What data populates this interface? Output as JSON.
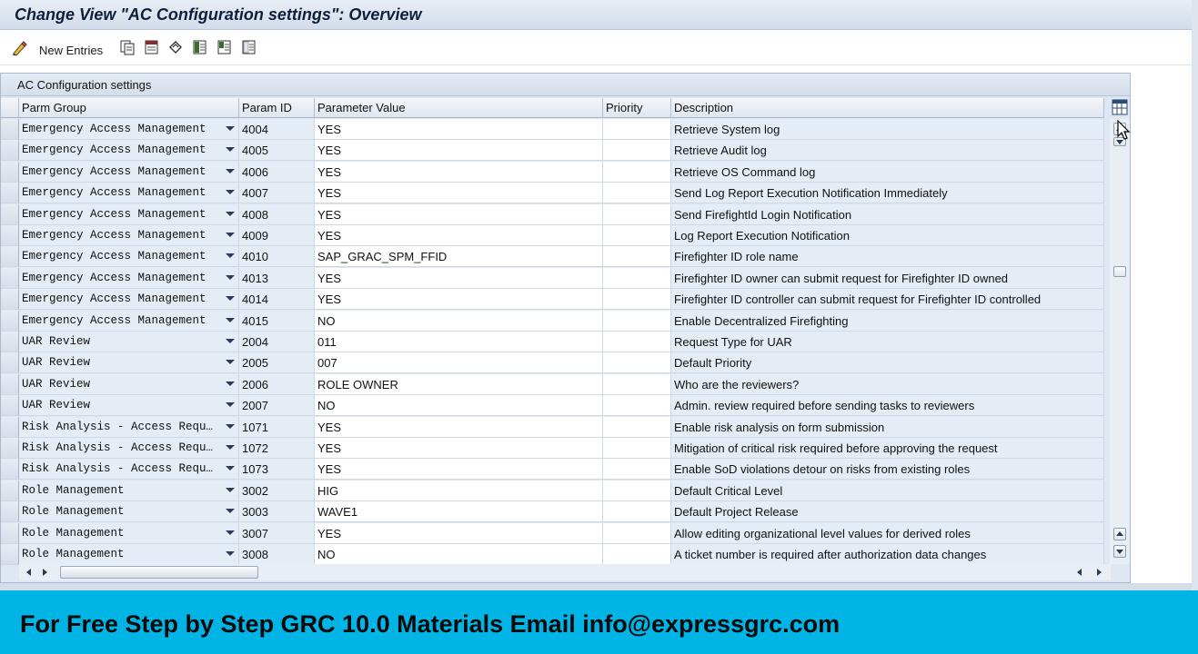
{
  "window": {
    "title": "Change View \"AC Configuration settings\": Overview"
  },
  "toolbar": {
    "new_entries_label": "New Entries",
    "icons": [
      "change-display-icon",
      "copy-as-icon",
      "delete-icon",
      "undo-change-icon",
      "select-all-icon",
      "select-block-icon",
      "deselect-all-icon"
    ]
  },
  "table": {
    "caption": "AC Configuration settings",
    "columns": [
      "Parm Group",
      "Param ID",
      "Parameter Value",
      "Priority",
      "Description"
    ],
    "rows": [
      {
        "group": "Emergency Access Management",
        "param_id": "4004",
        "value": "YES",
        "priority": "",
        "description": "Retrieve System log"
      },
      {
        "group": "Emergency Access Management",
        "param_id": "4005",
        "value": "YES",
        "priority": "",
        "description": "Retrieve Audit log"
      },
      {
        "group": "Emergency Access Management",
        "param_id": "4006",
        "value": "YES",
        "priority": "",
        "description": "Retrieve OS Command log"
      },
      {
        "group": "Emergency Access Management",
        "param_id": "4007",
        "value": "YES",
        "priority": "",
        "description": "Send Log Report Execution Notification Immediately"
      },
      {
        "group": "Emergency Access Management",
        "param_id": "4008",
        "value": "YES",
        "priority": "",
        "description": "Send FirefightId Login Notification"
      },
      {
        "group": "Emergency Access Management",
        "param_id": "4009",
        "value": "YES",
        "priority": "",
        "description": "Log Report Execution Notification"
      },
      {
        "group": "Emergency Access Management",
        "param_id": "4010",
        "value": "SAP_GRAC_SPM_FFID",
        "priority": "",
        "description": "Firefighter ID role name"
      },
      {
        "group": "Emergency Access Management",
        "param_id": "4013",
        "value": "YES",
        "priority": "",
        "description": "Firefighter ID owner can submit request for Firefighter ID owned"
      },
      {
        "group": "Emergency Access Management",
        "param_id": "4014",
        "value": "YES",
        "priority": "",
        "description": "Firefighter ID controller can submit request for Firefighter ID controlled"
      },
      {
        "group": "Emergency Access Management",
        "param_id": "4015",
        "value": "NO",
        "priority": "",
        "description": "Enable Decentralized Firefighting"
      },
      {
        "group": "UAR Review",
        "param_id": "2004",
        "value": "011",
        "priority": "",
        "description": "Request Type for UAR"
      },
      {
        "group": "UAR Review",
        "param_id": "2005",
        "value": "007",
        "priority": "",
        "description": "Default Priority"
      },
      {
        "group": "UAR Review",
        "param_id": "2006",
        "value": "ROLE OWNER",
        "priority": "",
        "description": "Who are the reviewers?"
      },
      {
        "group": "UAR Review",
        "param_id": "2007",
        "value": "NO",
        "priority": "",
        "description": "Admin. review required before sending tasks to reviewers"
      },
      {
        "group": "Risk Analysis - Access Requ…",
        "param_id": "1071",
        "value": "YES",
        "priority": "",
        "description": "Enable risk analysis on form submission"
      },
      {
        "group": "Risk Analysis - Access Requ…",
        "param_id": "1072",
        "value": "YES",
        "priority": "",
        "description": "Mitigation of critical risk required before approving the request"
      },
      {
        "group": "Risk Analysis - Access Requ…",
        "param_id": "1073",
        "value": "YES",
        "priority": "",
        "description": "Enable SoD violations detour on risks from existing roles"
      },
      {
        "group": "Role Management",
        "param_id": "3002",
        "value": "HIG",
        "priority": "",
        "description": "Default Critical Level"
      },
      {
        "group": "Role Management",
        "param_id": "3003",
        "value": "WAVE1",
        "priority": "",
        "description": "Default Project Release"
      },
      {
        "group": "Role Management",
        "param_id": "3007",
        "value": "YES",
        "priority": "",
        "description": "Allow editing organizational level values for derived roles"
      },
      {
        "group": "Role Management",
        "param_id": "3008",
        "value": "NO",
        "priority": "",
        "description": "A ticket number is required after authorization data changes"
      }
    ]
  },
  "banner": {
    "text": "For Free Step by Step GRC 10.0 Materials Email info@expressgrc.com"
  },
  "colors": {
    "banner_bg": "#00b4e6",
    "title_text": "#0e1f3c",
    "grid_bg": "#e4ecf5"
  }
}
